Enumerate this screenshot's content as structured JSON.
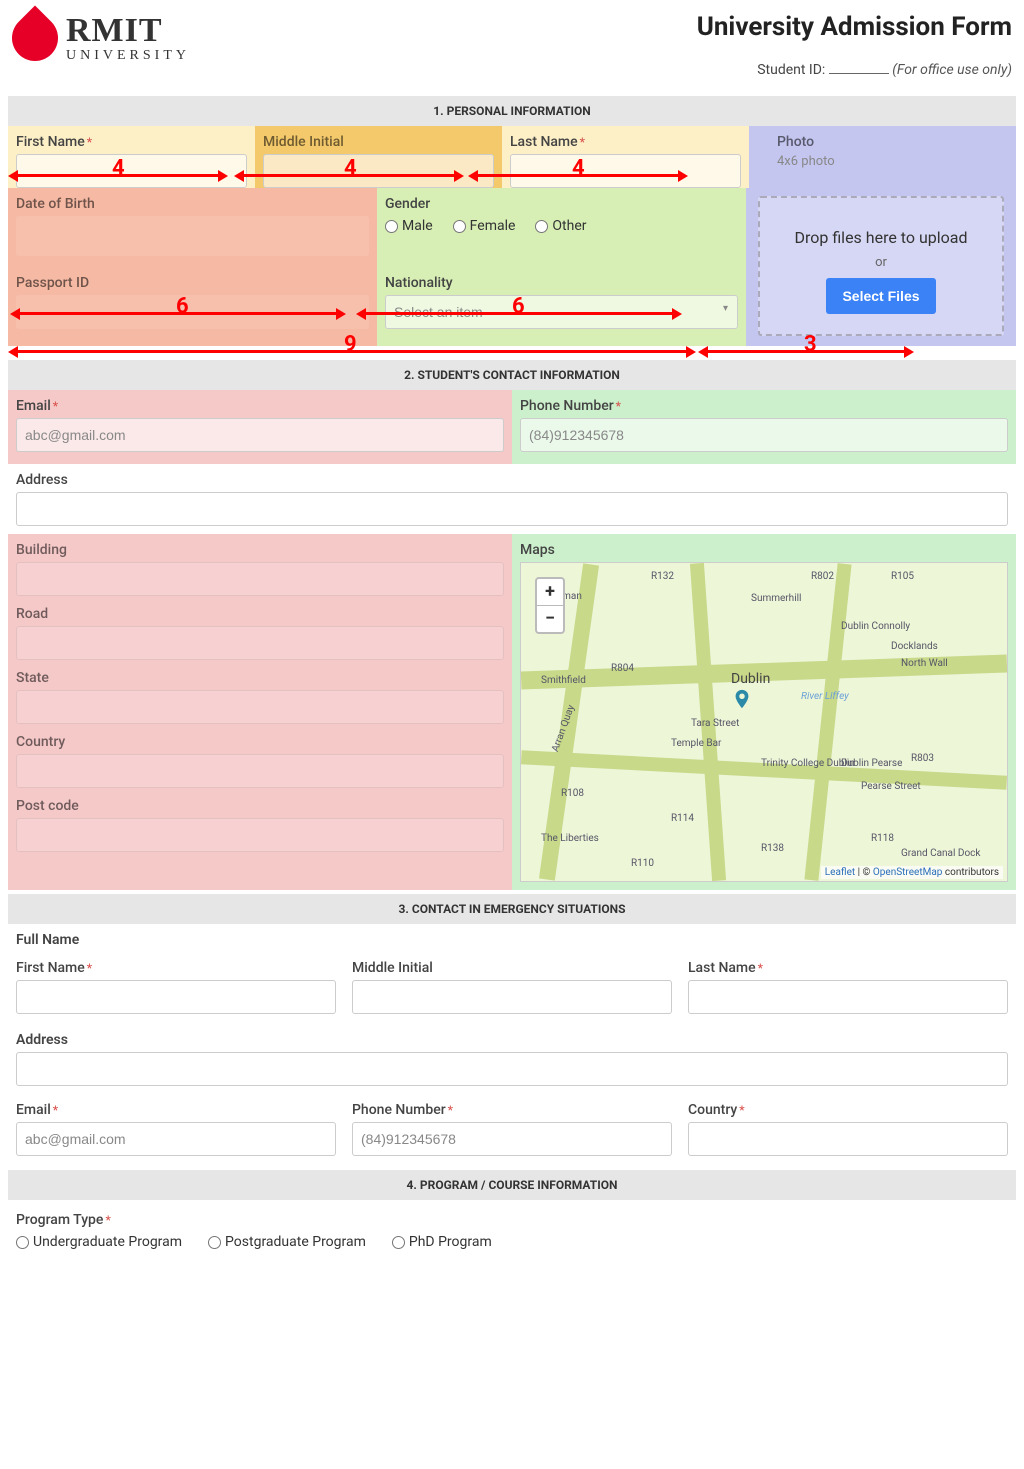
{
  "header": {
    "logo_name": "RMIT",
    "logo_sub": "UNIVERSITY",
    "title": "University Admission Form",
    "student_id_label": "Student ID:",
    "office_note": "(For office use only)"
  },
  "sections": {
    "s1": "1. PERSONAL INFORMATION",
    "s2": "2. STUDENT'S CONTACT INFORMATION",
    "s3": "3. CONTACT IN EMERGENCY SITUATIONS",
    "s4": "4. PROGRAM / COURSE INFORMATION"
  },
  "personal": {
    "first_name": "First Name",
    "middle_initial": "Middle Initial",
    "last_name": "Last Name",
    "dob": "Date of Birth",
    "passport": "Passport ID",
    "gender": "Gender",
    "gender_opts": {
      "m": "Male",
      "f": "Female",
      "o": "Other"
    },
    "nationality": "Nationality",
    "nationality_placeholder": "Select an item",
    "photo": "Photo",
    "photo_hint": "4x6 photo",
    "dropzone": "Drop files here to upload",
    "or": "or",
    "select_files": "Select Files"
  },
  "annotations": {
    "c4": "4",
    "c6": "6",
    "c9": "9",
    "c3": "3"
  },
  "contact": {
    "email": "Email",
    "email_placeholder": "abc@gmail.com",
    "phone": "Phone Number",
    "phone_placeholder": "(84)912345678",
    "address": "Address",
    "building": "Building",
    "road": "Road",
    "state": "State",
    "country": "Country",
    "postcode": "Post code",
    "maps": "Maps"
  },
  "map": {
    "city": "Dublin",
    "zoom_in": "+",
    "zoom_out": "−",
    "attrib_leaflet": "Leaflet",
    "attrib_sep": " | © ",
    "attrib_osm": "OpenStreetMap",
    "attrib_tail": " contributors",
    "labels": [
      "R132",
      "R802",
      "R105",
      "Summerhill",
      "Dublin Connolly",
      "North Wall",
      "Docklands",
      "Smithfield",
      "R804",
      "Arran Quay",
      "Temple Bar",
      "Tara Street",
      "River Liffey",
      "Trinity College Dublin",
      "Dublin Pearse",
      "Pearse Street",
      "R108",
      "R114",
      "R138",
      "R118",
      "R110",
      "The Liberties",
      "Grand Canal Dock",
      "R803",
      "ghman"
    ]
  },
  "emergency": {
    "fullname": "Full Name",
    "first_name": "First Name",
    "middle_initial": "Middle Initial",
    "last_name": "Last Name",
    "address": "Address",
    "email": "Email",
    "email_placeholder": "abc@gmail.com",
    "phone": "Phone Number",
    "phone_placeholder": "(84)912345678",
    "country": "Country"
  },
  "program": {
    "type_label": "Program Type",
    "opts": {
      "u": "Undergraduate Program",
      "p": "Postgraduate Program",
      "d": "PhD Program"
    }
  }
}
